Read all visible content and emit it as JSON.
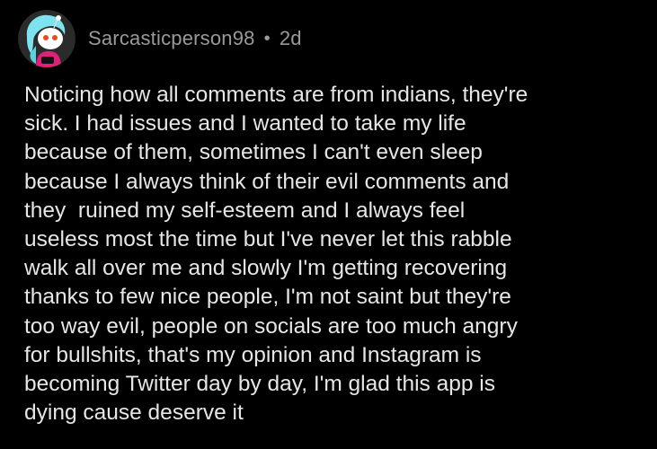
{
  "comment": {
    "author": {
      "username": "Sarcasticperson98",
      "avatar_icon": "snoo-avatar-icon"
    },
    "separator": "•",
    "age": "2d",
    "body_lines": [
      "Noticing how all comments are from indians, they're",
      "sick. I had issues and I wanted to take my life",
      "because of them, sometimes I can't even sleep",
      "because I always think of their evil comments and",
      "they  ruined my self-esteem and I always feel",
      "useless most the time but I've never let this rabble",
      "walk all over me and slowly I'm getting recovering",
      "thanks to few nice people, I'm not saint but they're",
      "too way evil, people on socials are too much angry",
      "for bullshits, that's my opinion and Instagram is",
      "becoming Twitter day by day, I'm glad this app is",
      "dying cause deserve it"
    ]
  },
  "colors": {
    "background": "#000000",
    "meta_text": "#9a9a9a",
    "body_text": "#e6e6e6",
    "avatar_bg": "#4fd1e0",
    "avatar_shirt": "#e0217a"
  }
}
